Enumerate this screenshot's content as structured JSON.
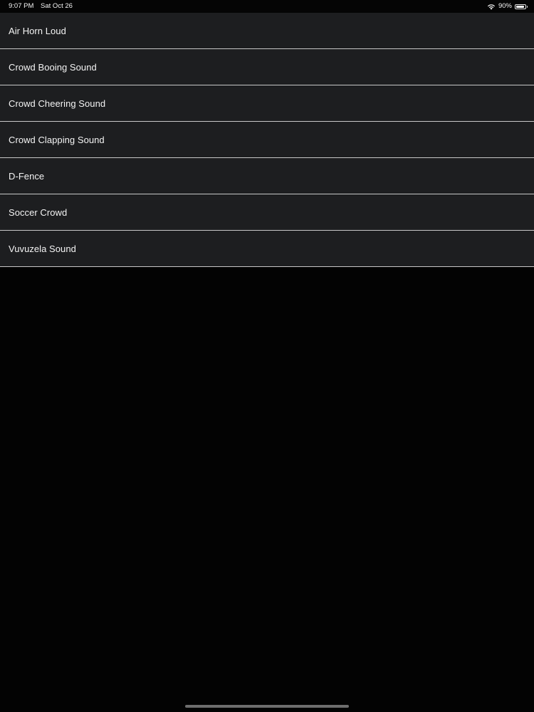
{
  "status_bar": {
    "time": "9:07 PM",
    "date": "Sat Oct 26",
    "wifi_icon": "wifi-icon",
    "battery_percent": "90%",
    "battery_level": 0.9,
    "battery_icon": "battery-icon"
  },
  "sounds": [
    {
      "label": "Air Horn Loud"
    },
    {
      "label": "Crowd Booing Sound"
    },
    {
      "label": "Crowd Cheering Sound"
    },
    {
      "label": "Crowd Clapping Sound"
    },
    {
      "label": "D-Fence"
    },
    {
      "label": "Soccer Crowd"
    },
    {
      "label": "Vuvuzela Sound"
    }
  ],
  "colors": {
    "background": "#030303",
    "row_background": "#1d1e20",
    "separator": "#c8c8c8",
    "text": "#f4f4f4"
  }
}
